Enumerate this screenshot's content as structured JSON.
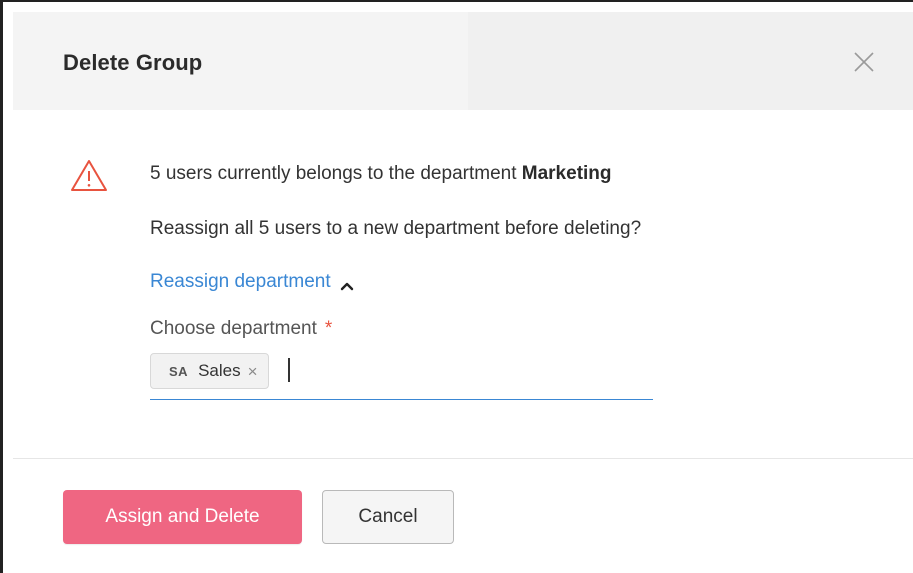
{
  "dialog": {
    "title": "Delete Group"
  },
  "message": {
    "line1_prefix": "5 users currently belongs to the department ",
    "department": "Marketing",
    "line2": "Reassign all 5 users to a new department before deleting?"
  },
  "reassign": {
    "toggle_label": "Reassign department",
    "field_label": "Choose department",
    "required_mark": "*",
    "selected": {
      "abbr": "SA",
      "name": "Sales",
      "remove": "×"
    }
  },
  "footer": {
    "primary_label": "Assign and Delete",
    "secondary_label": "Cancel"
  },
  "colors": {
    "primary": "#ef6682",
    "link": "#3a87d4",
    "warning": "#e8533f"
  },
  "icons": {
    "close": "close-icon",
    "warning": "warning-triangle-icon",
    "chevron": "chevron-up-icon"
  }
}
